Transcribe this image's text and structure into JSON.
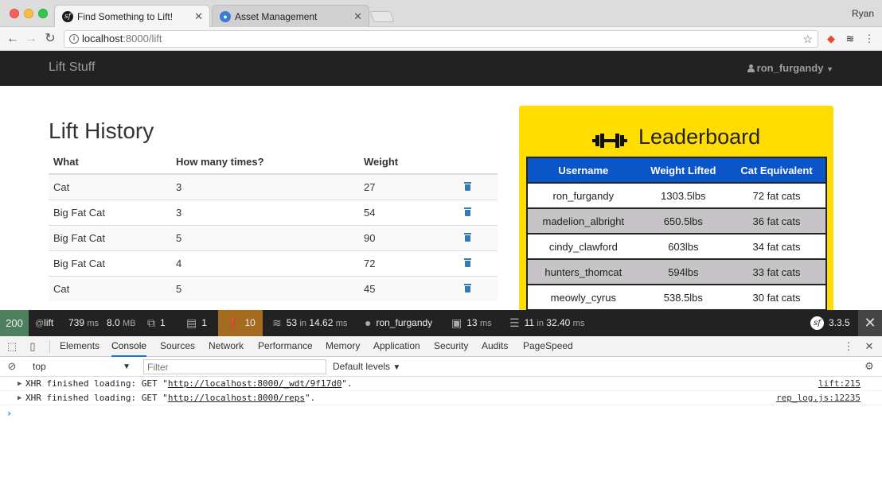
{
  "browser": {
    "os_user": "Ryan",
    "tabs": [
      {
        "title": "Find Something to Lift!",
        "favicon": "symfony-icon",
        "active": true
      },
      {
        "title": "Asset Management",
        "favicon": "globe-icon",
        "active": false
      }
    ],
    "close_glyph": "✕",
    "url_host": "localhost",
    "url_rest": ":8000/lift"
  },
  "navbar": {
    "brand": "Lift Stuff",
    "username": "ron_furgandy"
  },
  "lift_history": {
    "title": "Lift History",
    "columns": [
      "What",
      "How many times?",
      "Weight"
    ],
    "rows": [
      {
        "what": "Cat",
        "times": "3",
        "weight": "27"
      },
      {
        "what": "Big Fat Cat",
        "times": "3",
        "weight": "54"
      },
      {
        "what": "Big Fat Cat",
        "times": "5",
        "weight": "90"
      },
      {
        "what": "Big Fat Cat",
        "times": "4",
        "weight": "72"
      },
      {
        "what": "Cat",
        "times": "5",
        "weight": "45"
      }
    ]
  },
  "leaderboard": {
    "title": "Leaderboard",
    "columns": [
      "Username",
      "Weight Lifted",
      "Cat Equivalent"
    ],
    "rows": [
      {
        "username": "ron_furgandy",
        "weight": "1303.5lbs",
        "cats": "72 fat cats"
      },
      {
        "username": "madelion_albright",
        "weight": "650.5lbs",
        "cats": "36 fat cats"
      },
      {
        "username": "cindy_clawford",
        "weight": "603lbs",
        "cats": "34 fat cats"
      },
      {
        "username": "hunters_thomcat",
        "weight": "594lbs",
        "cats": "33 fat cats"
      },
      {
        "username": "meowly_cyrus",
        "weight": "538.5lbs",
        "cats": "30 fat cats"
      }
    ],
    "colors": {
      "background": "#ffdd00",
      "header": "#0a56c8",
      "stripe": "#c6c4c6"
    }
  },
  "sf_toolbar": {
    "status": "200",
    "route_at": "@",
    "route": "lift",
    "time_value": "739",
    "time_unit": "ms",
    "memory_value": "8.0",
    "memory_unit": "MB",
    "forms": "1",
    "logs": "1",
    "warnings": "10",
    "twig_count": "53",
    "twig_in": "in",
    "twig_time": "14.62",
    "twig_unit": "ms",
    "user": "ron_furgandy",
    "cache_value": "13",
    "cache_unit": "ms",
    "db_count": "11",
    "db_in": "in",
    "db_time": "32.40",
    "db_unit": "ms",
    "version": "3.3.5",
    "status_color": "#4f805d",
    "warn_color": "#a46a1f"
  },
  "devtools": {
    "tabs": [
      "Elements",
      "Console",
      "Sources",
      "Network",
      "Performance",
      "Memory",
      "Application",
      "Security",
      "Audits",
      "PageSpeed"
    ],
    "active_tab": "Console",
    "context": "top",
    "filter_placeholder": "Filter",
    "levels": "Default levels",
    "logs": [
      {
        "prefix": "XHR finished loading: GET \"",
        "url": "http://localhost:8000/_wdt/9f17d0",
        "suffix": "\".",
        "source": "lift:215"
      },
      {
        "prefix": "XHR finished loading: GET \"",
        "url": "http://localhost:8000/reps",
        "suffix": "\".",
        "source": "rep_log.js:12235"
      }
    ],
    "prompt": "›"
  }
}
